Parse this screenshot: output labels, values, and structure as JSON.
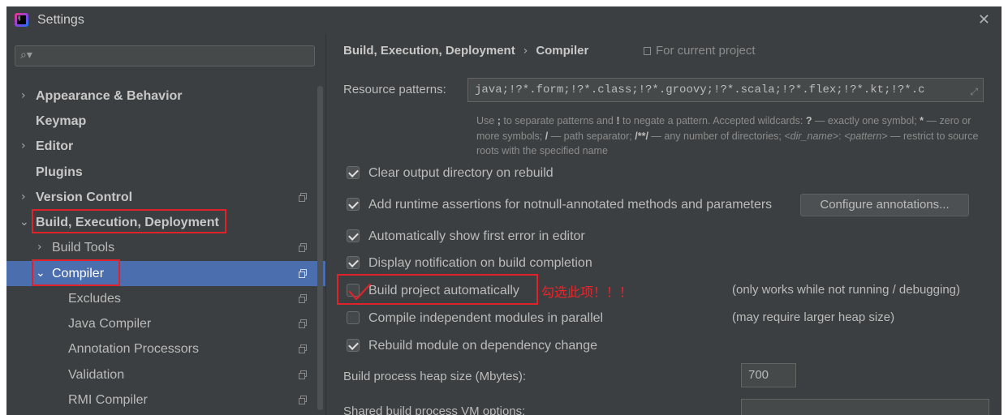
{
  "window": {
    "title": "Settings"
  },
  "search": {
    "placeholder": ""
  },
  "sidebar": {
    "items": [
      {
        "label": "Appearance & Behavior",
        "chevron": ">",
        "bold": true
      },
      {
        "label": "Keymap",
        "bold": true
      },
      {
        "label": "Editor",
        "chevron": ">",
        "bold": true
      },
      {
        "label": "Plugins",
        "bold": true
      },
      {
        "label": "Version Control",
        "chevron": ">",
        "bold": true,
        "project_icon": true
      },
      {
        "label": "Build, Execution, Deployment",
        "chevron": "v",
        "bold": true,
        "expanded": true
      },
      {
        "label": "Build Tools",
        "chevron": ">",
        "project_icon": true
      },
      {
        "label": "Compiler",
        "chevron": "v",
        "selected": true,
        "project_icon": true
      },
      {
        "label": "Excludes",
        "project_icon": true
      },
      {
        "label": "Java Compiler",
        "project_icon": true
      },
      {
        "label": "Annotation Processors",
        "project_icon": true
      },
      {
        "label": "Validation",
        "project_icon": true
      },
      {
        "label": "RMI Compiler",
        "project_icon": true
      }
    ]
  },
  "breadcrumb": {
    "parent": "Build, Execution, Deployment",
    "separator": "›",
    "current": "Compiler",
    "scope": "For current project"
  },
  "resource": {
    "label": "Resource patterns:",
    "value": "java;!?*.form;!?*.class;!?*.groovy;!?*.scala;!?*.flex;!?*.kt;!?*.c"
  },
  "hint": {
    "p1": "Use ",
    "semicolon": ";",
    "p2": " to separate patterns and ",
    "bang": "!",
    "p3": " to negate a pattern. Accepted wildcards: ",
    "q": "?",
    "p4": " — exactly one symbol; ",
    "star": "*",
    "p5": " — zero or more symbols; ",
    "slash": "/",
    "p6": " — path separator; ",
    "dstar": "/**/",
    "p7": " — any number of directories; ",
    "dirname": "<dir_name>",
    "p8": ":",
    "pattern": "<pattern>",
    "p9": " — restrict to source roots with the specified name"
  },
  "options": [
    {
      "label": "Clear output directory on rebuild",
      "checked": true
    },
    {
      "label": "Add runtime assertions for notnull-annotated methods and parameters",
      "checked": true
    },
    {
      "label": "Automatically show first error in editor",
      "checked": true
    },
    {
      "label": "Display notification on build completion",
      "checked": true
    },
    {
      "label": "Build project automatically",
      "checked": false,
      "note": "(only works while not running / debugging)"
    },
    {
      "label": "Compile independent modules in parallel",
      "checked": false,
      "note": "(may require larger heap size)"
    },
    {
      "label": "Rebuild module on dependency change",
      "checked": true
    }
  ],
  "configure_button": "Configure annotations...",
  "annotation_text": "勾选此项！！！",
  "heap": {
    "label": "Build process heap size (Mbytes):",
    "value": "700"
  },
  "vm": {
    "label": "Shared build process VM options:",
    "value": ""
  },
  "colors": {
    "background": "#3c3f41",
    "selection": "#4b6eaf",
    "annotation": "#e0232a"
  }
}
